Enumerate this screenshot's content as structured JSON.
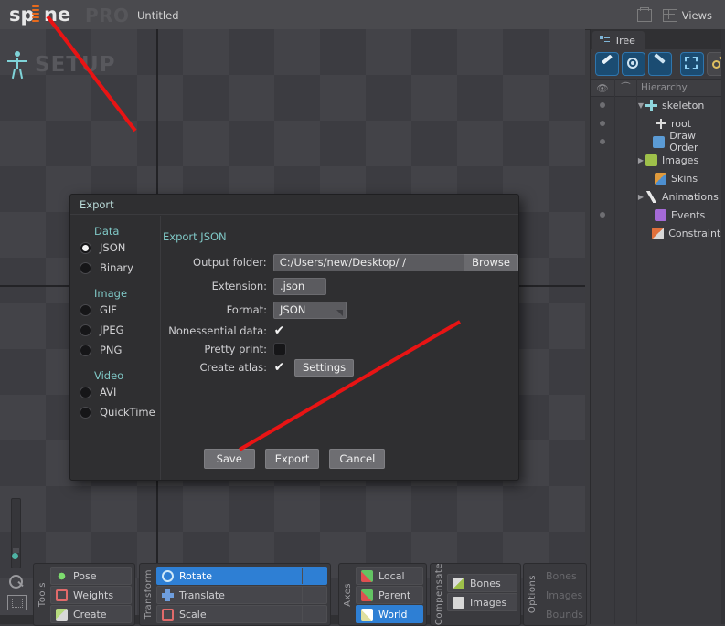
{
  "titlebar": {
    "logo_sp": "sp",
    "logo_ne": "ne",
    "logo_pro": "PRO",
    "document_title": "Untitled",
    "print_icon": "print-icon",
    "views_icon": "views-layout-icon",
    "views_label": "Views"
  },
  "viewport": {
    "mode_label": "SETUP",
    "skeleton_icon": "skeleton-person-icon"
  },
  "left_toolbar": {
    "zoom_icon": "magnifier-icon",
    "frame_icon": "frame-selection-icon",
    "slider_name": "viewport-zoom-slider"
  },
  "tools_panel": {
    "group_label": "Tools",
    "items": [
      {
        "label": "Pose",
        "icon": "pose-icon",
        "color": "#4caf50",
        "selected": false
      },
      {
        "label": "Weights",
        "icon": "weights-icon",
        "color": "#e05050",
        "selected": false
      },
      {
        "label": "Create",
        "icon": "create-icon",
        "color": "#9ecb62",
        "selected": false
      }
    ]
  },
  "transform_panel": {
    "group_label": "Transform",
    "items": [
      {
        "label": "Rotate",
        "icon": "rotate-icon",
        "color": "#3fa9d6",
        "selected": true
      },
      {
        "label": "Translate",
        "icon": "translate-icon",
        "color": "#5b8fd6",
        "selected": false
      },
      {
        "label": "Scale",
        "icon": "scale-icon",
        "color": "#d65252",
        "selected": false
      }
    ]
  },
  "axes_panel": {
    "group_label": "Axes",
    "items": [
      {
        "label": "Local",
        "icon": "axes-local-icon",
        "selected": false
      },
      {
        "label": "Parent",
        "icon": "axes-parent-icon",
        "selected": false
      },
      {
        "label": "World",
        "icon": "axes-world-icon",
        "selected": true
      }
    ]
  },
  "compensate_panel": {
    "group_label": "Compensate",
    "items": [
      {
        "label": "Bones",
        "icon": "compensate-bones-icon",
        "selected": false
      },
      {
        "label": "Images",
        "icon": "compensate-images-icon",
        "selected": false
      }
    ]
  },
  "options_panel": {
    "group_label": "Options",
    "items": [
      {
        "label": "Bones",
        "selected": false
      },
      {
        "label": "Images",
        "selected": false
      },
      {
        "label": "Bounds",
        "selected": false
      }
    ]
  },
  "tree_panel": {
    "tab_label": "Tree",
    "toolbar_icons": [
      "brush-tool-icon",
      "circle-select-icon",
      "ghost-tool-icon",
      "select-box-icon",
      "key-tool-icon"
    ],
    "columns": {
      "visibility": "eye-icon",
      "bone": "bone-icon",
      "hierarchy": "Hierarchy"
    },
    "rows": [
      {
        "label": "skeleton",
        "icon": "skeleton-icon",
        "color": "#8fd6dd",
        "indent": 1,
        "expander": "open",
        "dot": true
      },
      {
        "label": "root",
        "icon": "root-icon",
        "color": "#cfcfcf",
        "indent": 2,
        "expander": "none",
        "dot": true
      },
      {
        "label": "Draw Order",
        "icon": "draw-order-icon",
        "color": "#5b9bd5",
        "indent": 2,
        "expander": "none",
        "dot": true
      },
      {
        "label": "Images",
        "icon": "images-icon",
        "color": "#9ec04a",
        "indent": 2,
        "expander": "closed",
        "dot": false
      },
      {
        "label": "Skins",
        "icon": "skins-icon",
        "color": "#e09a3c",
        "indent": 2,
        "expander": "none",
        "dot": false
      },
      {
        "label": "Animations",
        "icon": "animations-icon",
        "color": "#d8d8d8",
        "indent": 2,
        "expander": "closed",
        "dot": false
      },
      {
        "label": "Events",
        "icon": "events-icon",
        "color": "#a46ad6",
        "indent": 2,
        "expander": "none",
        "dot": true
      },
      {
        "label": "Constraints",
        "icon": "constraints-icon",
        "color": "#e0703c",
        "indent": 2,
        "expander": "none",
        "dot": false
      }
    ]
  },
  "export_dialog": {
    "title": "Export",
    "subtitle": "Export JSON",
    "sections": [
      {
        "heading": "Data",
        "options": [
          {
            "label": "JSON",
            "selected": true
          },
          {
            "label": "Binary",
            "selected": false
          }
        ]
      },
      {
        "heading": "Image",
        "options": [
          {
            "label": "GIF",
            "selected": false
          },
          {
            "label": "JPEG",
            "selected": false
          },
          {
            "label": "PNG",
            "selected": false
          }
        ]
      },
      {
        "heading": "Video",
        "options": [
          {
            "label": "AVI",
            "selected": false
          },
          {
            "label": "QuickTime",
            "selected": false
          }
        ]
      }
    ],
    "fields": {
      "output_folder_label": "Output folder:",
      "output_folder_value": "C:/Users/new/Desktop/   /",
      "browse_label": "Browse",
      "extension_label": "Extension:",
      "extension_value": ".json",
      "format_label": "Format:",
      "format_value": "JSON",
      "nonessential_label": "Nonessential data:",
      "nonessential_checked": true,
      "pretty_print_label": "Pretty print:",
      "pretty_print_checked": false,
      "create_atlas_label": "Create atlas:",
      "create_atlas_checked": true,
      "settings_label": "Settings",
      "check_glyph": "✔"
    },
    "buttons": [
      {
        "label": "Save"
      },
      {
        "label": "Export"
      },
      {
        "label": "Cancel"
      }
    ]
  },
  "annotations": {
    "arrow_color": "#e81414",
    "arrow_top": "arrow-pointing-to-spine-logo",
    "arrow_bottom": "arrow-pointing-to-save-button"
  }
}
